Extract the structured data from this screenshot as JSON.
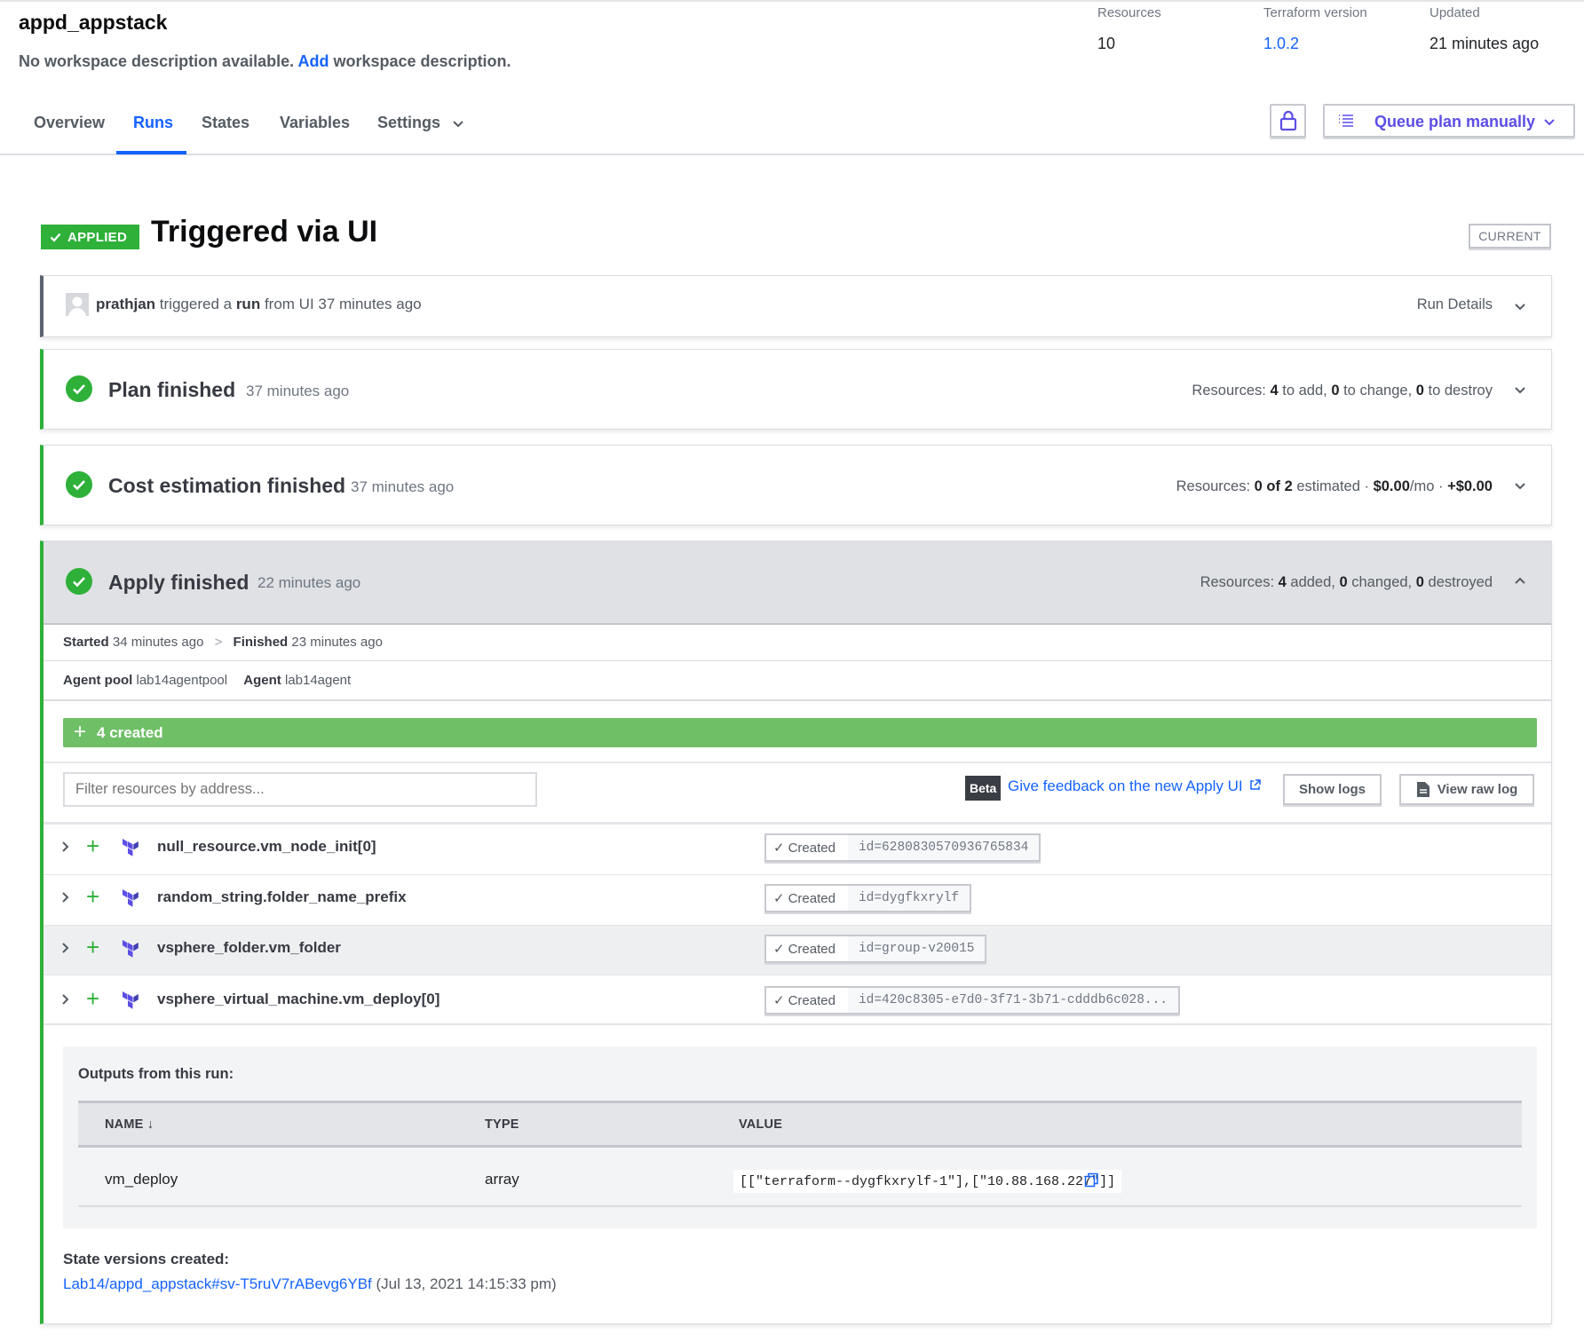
{
  "workspace": {
    "title": "appd_appstack",
    "desc_prefix": "No workspace description available.",
    "desc_link": "Add",
    "desc_suffix": "workspace description."
  },
  "stats": [
    {
      "label": "Resources",
      "value": "10"
    },
    {
      "label": "Terraform version",
      "value": "1.0.2"
    },
    {
      "label": "Updated",
      "value": "21 minutes ago"
    }
  ],
  "tabs": [
    "Overview",
    "Runs",
    "States",
    "Variables",
    "Settings"
  ],
  "active_tab": "Runs",
  "queue_button": "Queue plan manually",
  "run": {
    "status_badge": "APPLIED",
    "title": "Triggered via UI",
    "current_badge": "CURRENT"
  },
  "trigger": {
    "user": "prathjan",
    "text_1": "triggered a",
    "run_word": "run",
    "text_2": "from UI 37 minutes ago",
    "details": "Run Details"
  },
  "plan": {
    "title": "Plan finished",
    "time": "37 minutes ago",
    "res_label": "Resources:",
    "add": "4",
    "add_label": "to add,",
    "change": "0",
    "change_label": "to change,",
    "destroy": "0",
    "destroy_label": "to destroy"
  },
  "cost": {
    "title": "Cost estimation finished",
    "time": "37 minutes ago",
    "res_label": "Resources:",
    "estimated": "0 of 2",
    "estimated_label": "estimated ·",
    "monthly": "$0.00",
    "monthly_unit": "/mo ·",
    "delta": "+$0.00"
  },
  "apply": {
    "title": "Apply finished",
    "time": "22 minutes ago",
    "res_label": "Resources:",
    "added": "4",
    "added_label": "added,",
    "changed": "0",
    "changed_label": "changed,",
    "destroyed": "0",
    "destroyed_label": "destroyed",
    "started_label": "Started",
    "started": "34 minutes ago",
    "finished_label": "Finished",
    "finished": "23 minutes ago",
    "pool_label": "Agent pool",
    "pool": "lab14agentpool",
    "agent_label": "Agent",
    "agent": "lab14agent",
    "created_bar": "4 created",
    "filter_placeholder": "Filter resources by address...",
    "beta": "Beta",
    "feedback": "Give feedback on the new Apply UI",
    "show_logs": "Show logs",
    "view_raw": "View raw log"
  },
  "resources": [
    {
      "name": "null_resource.vm_node_init[0]",
      "status": "Created",
      "id": "id=6280830570936765834"
    },
    {
      "name": "random_string.folder_name_prefix",
      "status": "Created",
      "id": "id=dygfkxrylf"
    },
    {
      "name": "vsphere_folder.vm_folder",
      "status": "Created",
      "id": "id=group-v20015"
    },
    {
      "name": "vsphere_virtual_machine.vm_deploy[0]",
      "status": "Created",
      "id": "id=420c8305-e7d0-3f71-3b71-cdddb6c028..."
    }
  ],
  "outputs": {
    "label": "Outputs from this run:",
    "columns": [
      "NAME ↓",
      "TYPE",
      "VALUE"
    ],
    "rows": [
      {
        "name": "vm_deploy",
        "type": "array",
        "value": "[[\"terraform--dygfkxrylf-1\"],[\"10.88.168.227\"]]"
      }
    ]
  },
  "state_versions": {
    "label": "State versions created:",
    "link": "Lab14/appd_appstack#sv-T5ruV7rABevg6YBf",
    "date": "(Jul 13, 2021 14:15:33 pm)"
  },
  "colors": {
    "accent": "#1563ff",
    "success": "#2eb039",
    "created_bar": "#6fbf67",
    "terraform_purple": "#5c4ee5"
  }
}
